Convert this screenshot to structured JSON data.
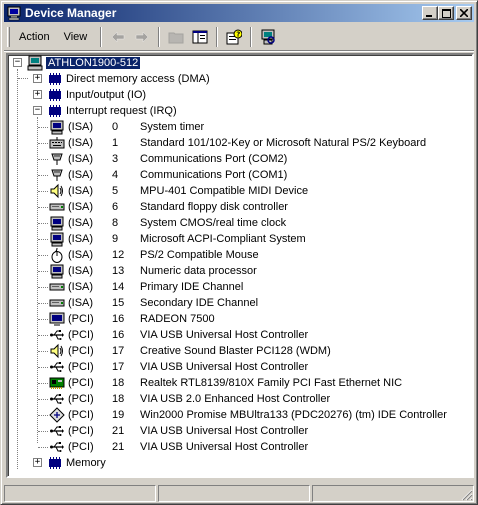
{
  "window": {
    "title": "Device Manager"
  },
  "menu": {
    "action": "Action",
    "view": "View"
  },
  "tree": {
    "root": "ATHLON1900-512",
    "categories": [
      "Direct memory access (DMA)",
      "Input/output (IO)",
      "Interrupt request (IRQ)"
    ],
    "irq_entries": [
      {
        "bus": "(ISA)",
        "irq": "0",
        "name": "System timer",
        "icon": "system-device-icon"
      },
      {
        "bus": "(ISA)",
        "irq": "1",
        "name": "Standard 101/102-Key or Microsoft Natural PS/2 Keyboard",
        "icon": "keyboard-icon"
      },
      {
        "bus": "(ISA)",
        "irq": "3",
        "name": "Communications Port (COM2)",
        "icon": "port-icon"
      },
      {
        "bus": "(ISA)",
        "irq": "4",
        "name": "Communications Port (COM1)",
        "icon": "port-icon"
      },
      {
        "bus": "(ISA)",
        "irq": "5",
        "name": "MPU-401 Compatible MIDI Device",
        "icon": "speaker-icon"
      },
      {
        "bus": "(ISA)",
        "irq": "6",
        "name": "Standard floppy disk controller",
        "icon": "disk-controller-icon"
      },
      {
        "bus": "(ISA)",
        "irq": "8",
        "name": "System CMOS/real time clock",
        "icon": "system-device-icon"
      },
      {
        "bus": "(ISA)",
        "irq": "9",
        "name": "Microsoft ACPI-Compliant System",
        "icon": "system-device-icon"
      },
      {
        "bus": "(ISA)",
        "irq": "12",
        "name": "PS/2 Compatible Mouse",
        "icon": "mouse-icon"
      },
      {
        "bus": "(ISA)",
        "irq": "13",
        "name": "Numeric data processor",
        "icon": "system-device-icon"
      },
      {
        "bus": "(ISA)",
        "irq": "14",
        "name": "Primary IDE Channel",
        "icon": "disk-controller-icon"
      },
      {
        "bus": "(ISA)",
        "irq": "15",
        "name": "Secondary IDE Channel",
        "icon": "disk-controller-icon"
      },
      {
        "bus": "(PCI)",
        "irq": "16",
        "name": "RADEON 7500",
        "icon": "monitor-icon"
      },
      {
        "bus": "(PCI)",
        "irq": "16",
        "name": "VIA USB Universal Host Controller",
        "icon": "usb-icon"
      },
      {
        "bus": "(PCI)",
        "irq": "17",
        "name": "Creative Sound Blaster PCI128 (WDM)",
        "icon": "speaker-icon"
      },
      {
        "bus": "(PCI)",
        "irq": "17",
        "name": "VIA USB Universal Host Controller",
        "icon": "usb-icon"
      },
      {
        "bus": "(PCI)",
        "irq": "18",
        "name": "Realtek RTL8139/810X Family PCI Fast Ethernet NIC",
        "icon": "network-card-icon"
      },
      {
        "bus": "(PCI)",
        "irq": "18",
        "name": "VIA USB 2.0 Enhanced Host Controller",
        "icon": "usb-icon"
      },
      {
        "bus": "(PCI)",
        "irq": "19",
        "name": "Win2000 Promise MBUltra133 (PDC20276) (tm) IDE Controller",
        "icon": "scsi-controller-icon"
      },
      {
        "bus": "(PCI)",
        "irq": "21",
        "name": "VIA USB Universal Host Controller",
        "icon": "usb-icon"
      },
      {
        "bus": "(PCI)",
        "irq": "21",
        "name": "VIA USB Universal Host Controller",
        "icon": "usb-icon"
      }
    ],
    "last_category": "Memory"
  }
}
